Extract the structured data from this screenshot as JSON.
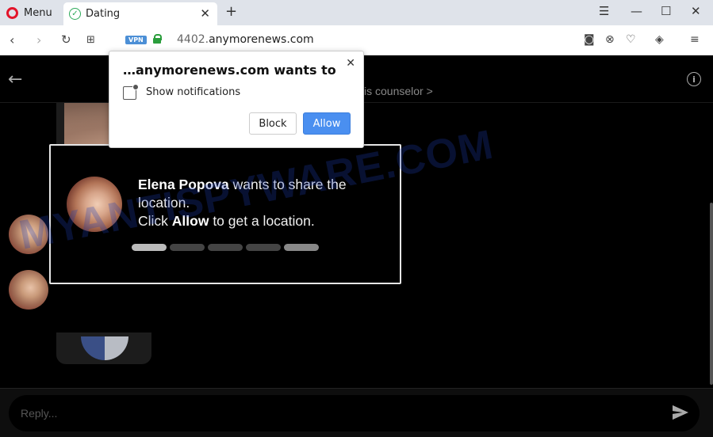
{
  "browser": {
    "menu_label": "Menu",
    "tab_title": "Dating",
    "new_tab": "+",
    "vpn_badge": "VPN",
    "url_prefix": "4402.",
    "url_domain": "anymorenews.com"
  },
  "page": {
    "header_text": "sis counselor >",
    "reply_placeholder": "Reply..."
  },
  "location_popup": {
    "name": "Elena Popova",
    "line1_rest": " wants to share the location.",
    "click": "Click ",
    "allow_word": "Allow",
    "line2_rest": " to get a location.",
    "progress_filled": 1,
    "progress_total": 5
  },
  "notification_prompt": {
    "title": "…anymorenews.com wants to",
    "permission_label": "Show notifications",
    "block_label": "Block",
    "allow_label": "Allow"
  },
  "watermark": "MYANTISPYWARE.COM",
  "colors": {
    "allow_button": "#4a8ff0",
    "opera_red": "#e3142a",
    "secure_green": "#2a9d3c",
    "vpn_blue": "#4c8fd6"
  }
}
